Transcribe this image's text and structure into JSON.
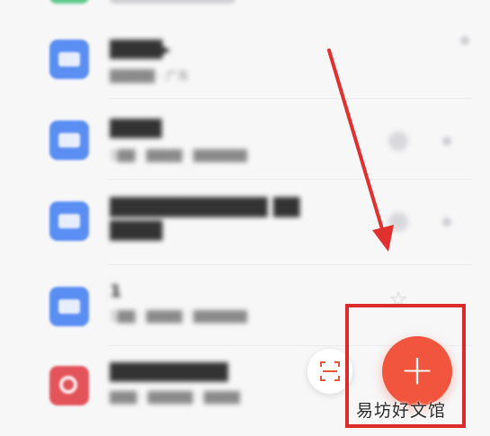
{
  "files": [
    {
      "title": "████▸",
      "meta": "█████ · 广东"
    },
    {
      "title": "████",
      "meta": "1██ · ████ · ██████"
    },
    {
      "title": "████████████ ██\n████",
      "meta": ""
    },
    {
      "title": "1",
      "meta": "1██ · ████ · ██████"
    },
    {
      "title": "█████████",
      "meta": "███ · █████ · ████"
    }
  ],
  "fab": {
    "icon": "+"
  },
  "watermark": "易坊好文馆",
  "colors": {
    "fab": "#f2553d",
    "highlight": "#dc2b2b",
    "file_icon": "#5b8ef2",
    "file_icon_red": "#e2545a"
  }
}
